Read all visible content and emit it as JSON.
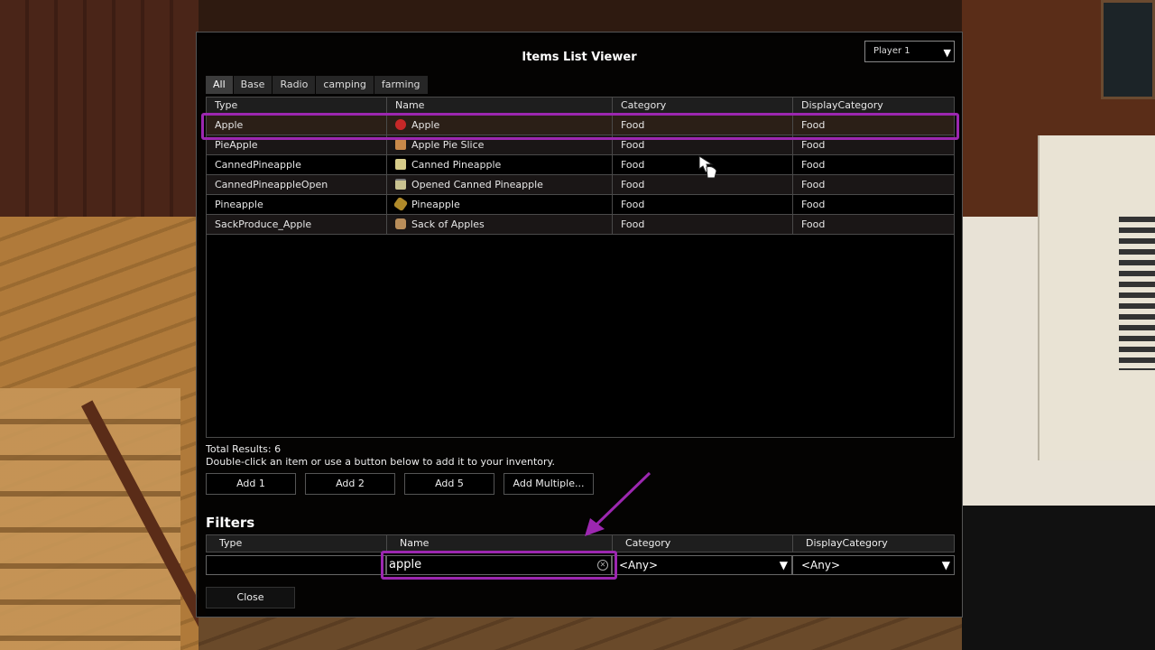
{
  "window": {
    "title": "Items List Viewer",
    "player_select": "Player 1"
  },
  "tabs": [
    "All",
    "Base",
    "Radio",
    "camping",
    "farming"
  ],
  "table": {
    "columns": [
      "Type",
      "Name",
      "Category",
      "DisplayCategory"
    ],
    "rows": [
      {
        "type": "Apple",
        "name": "Apple",
        "icon": "apple-icon",
        "category": "Food",
        "display_category": "Food"
      },
      {
        "type": "PieApple",
        "name": "Apple Pie Slice",
        "icon": "pie-icon",
        "category": "Food",
        "display_category": "Food"
      },
      {
        "type": "CannedPineapple",
        "name": "Canned Pineapple",
        "icon": "can-icon",
        "category": "Food",
        "display_category": "Food"
      },
      {
        "type": "CannedPineappleOpen",
        "name": "Opened Canned Pineapple",
        "icon": "open-can-icon",
        "category": "Food",
        "display_category": "Food"
      },
      {
        "type": "Pineapple",
        "name": "Pineapple",
        "icon": "pineapple-icon",
        "category": "Food",
        "display_category": "Food"
      },
      {
        "type": "SackProduce_Apple",
        "name": "Sack of Apples",
        "icon": "sack-icon",
        "category": "Food",
        "display_category": "Food"
      }
    ]
  },
  "results": {
    "total_label": "Total Results: 6",
    "hint": "Double-click an item or use a button below to add it to your inventory."
  },
  "buttons": {
    "add1": "Add 1",
    "add2": "Add 2",
    "add5": "Add 5",
    "add_multiple": "Add Multiple...",
    "close": "Close"
  },
  "filters": {
    "title": "Filters",
    "columns": [
      "Type",
      "Name",
      "Category",
      "DisplayCategory"
    ],
    "type_value": "",
    "name_value": "apple",
    "category_value": "<Any>",
    "display_category_value": "<Any>"
  },
  "colors": {
    "highlight": "#9c27b0",
    "panel_bg": "#000000"
  }
}
